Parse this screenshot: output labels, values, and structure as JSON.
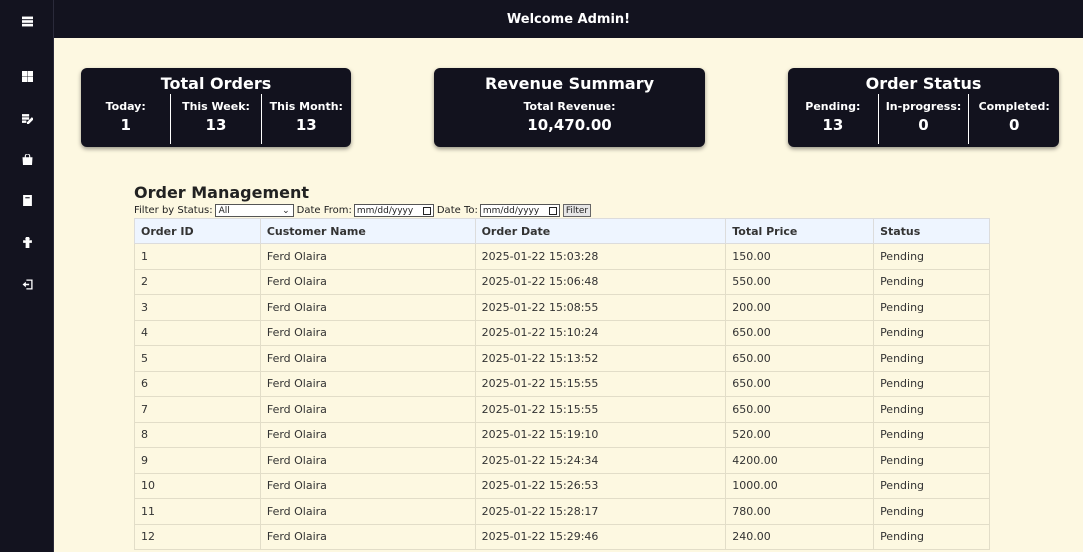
{
  "header": {
    "title": "Welcome Admin!"
  },
  "sidebar": {
    "icons": [
      "menu-icon",
      "dashboard-icon",
      "orders-icon",
      "products-icon",
      "book-icon",
      "user-icon",
      "logout-icon"
    ]
  },
  "cards": {
    "total_orders": {
      "title": "Total Orders",
      "today_label": "Today:",
      "today_value": "1",
      "week_label": "This Week:",
      "week_value": "13",
      "month_label": "This Month:",
      "month_value": "13"
    },
    "revenue": {
      "title": "Revenue Summary",
      "total_label": "Total Revenue:",
      "total_value": "10,470.00"
    },
    "status": {
      "title": "Order Status",
      "pending_label": "Pending:",
      "pending_value": "13",
      "inprogress_label": "In-progress:",
      "inprogress_value": "0",
      "completed_label": "Completed:",
      "completed_value": "0"
    }
  },
  "orders": {
    "title": "Order Management",
    "filter": {
      "status_label": "Filter by Status:",
      "status_value": "All",
      "date_from_label": "Date From:",
      "date_from_placeholder": "mm/dd/yyyy",
      "date_to_label": "Date To:",
      "date_to_placeholder": "mm/dd/yyyy",
      "button_label": "Filter"
    },
    "columns": [
      "Order ID",
      "Customer Name",
      "Order Date",
      "Total Price",
      "Status"
    ],
    "rows": [
      [
        "1",
        "Ferd Olaira",
        "2025-01-22 15:03:28",
        "150.00",
        "Pending"
      ],
      [
        "2",
        "Ferd Olaira",
        "2025-01-22 15:06:48",
        "550.00",
        "Pending"
      ],
      [
        "3",
        "Ferd Olaira",
        "2025-01-22 15:08:55",
        "200.00",
        "Pending"
      ],
      [
        "4",
        "Ferd Olaira",
        "2025-01-22 15:10:24",
        "650.00",
        "Pending"
      ],
      [
        "5",
        "Ferd Olaira",
        "2025-01-22 15:13:52",
        "650.00",
        "Pending"
      ],
      [
        "6",
        "Ferd Olaira",
        "2025-01-22 15:15:55",
        "650.00",
        "Pending"
      ],
      [
        "7",
        "Ferd Olaira",
        "2025-01-22 15:15:55",
        "650.00",
        "Pending"
      ],
      [
        "8",
        "Ferd Olaira",
        "2025-01-22 15:19:10",
        "520.00",
        "Pending"
      ],
      [
        "9",
        "Ferd Olaira",
        "2025-01-22 15:24:34",
        "4200.00",
        "Pending"
      ],
      [
        "10",
        "Ferd Olaira",
        "2025-01-22 15:26:53",
        "1000.00",
        "Pending"
      ],
      [
        "11",
        "Ferd Olaira",
        "2025-01-22 15:28:17",
        "780.00",
        "Pending"
      ],
      [
        "12",
        "Ferd Olaira",
        "2025-01-22 15:29:46",
        "240.00",
        "Pending"
      ]
    ]
  }
}
